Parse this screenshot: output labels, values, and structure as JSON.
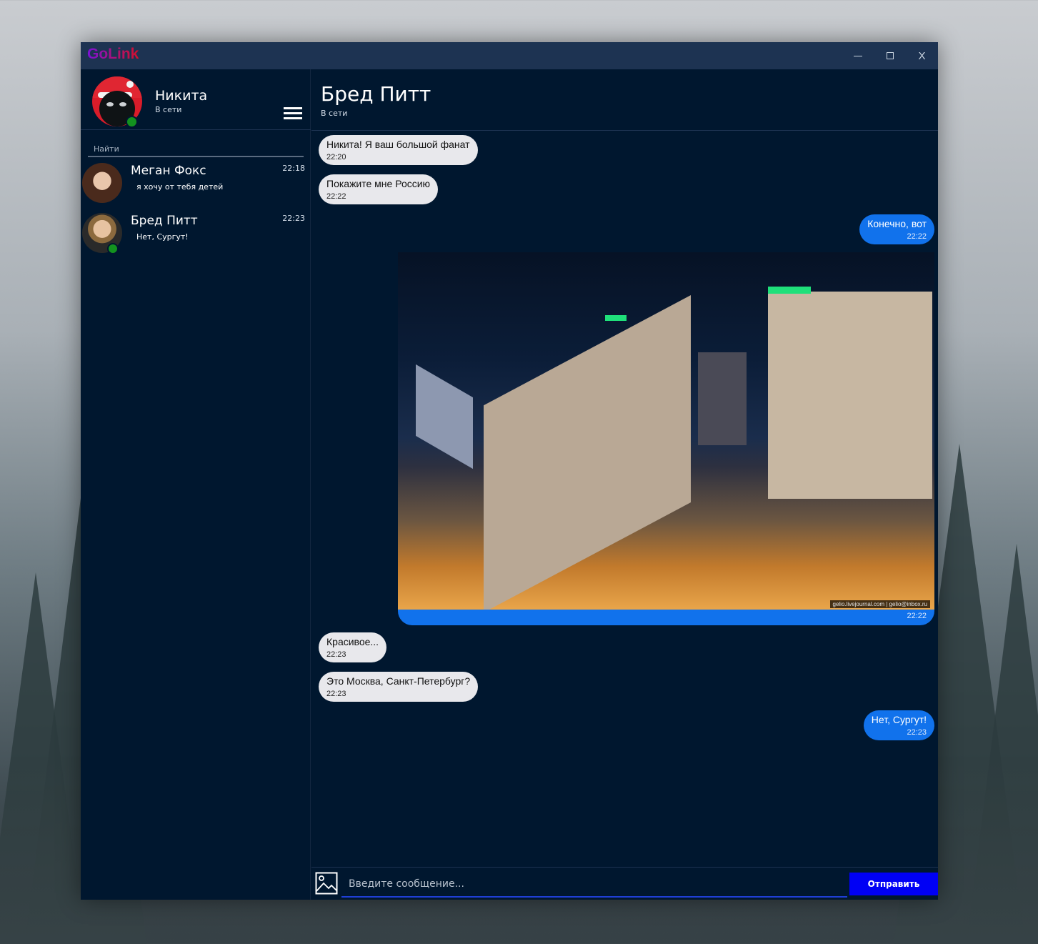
{
  "app": {
    "title": "GoLink"
  },
  "window_controls": {
    "minimize": "—",
    "maximize": "☐",
    "close": "X"
  },
  "profile": {
    "name": "Никита",
    "status": "В сети"
  },
  "search": {
    "placeholder": "Найти"
  },
  "contacts": [
    {
      "name": "Меган Фокс",
      "last_message": "я хочу от тебя детей",
      "time": "22:18",
      "online": false
    },
    {
      "name": "Бред Питт",
      "last_message": "Нет, Сургут!",
      "time": "22:23",
      "online": true
    }
  ],
  "chat": {
    "title": "Бред Питт",
    "status": "В сети",
    "messages": [
      {
        "dir": "in",
        "text": "Никита! Я ваш большой фанат",
        "time": "22:20"
      },
      {
        "dir": "in",
        "text": "Покажите мне Россию",
        "time": "22:22"
      },
      {
        "dir": "out",
        "text": "Конечно, вот",
        "time": "22:22"
      },
      {
        "dir": "out",
        "type": "image",
        "caption": "gelio.livejournal.com | gelio@inbox.ru",
        "time": "22:22"
      },
      {
        "dir": "in",
        "text": "Красивое...",
        "time": "22:23"
      },
      {
        "dir": "in",
        "text": "Это Москва, Санкт-Петербург?",
        "time": "22:23"
      },
      {
        "dir": "out",
        "text": "Нет, Сургут!",
        "time": "22:23"
      }
    ]
  },
  "composer": {
    "placeholder": "Введите сообщение...",
    "send_label": "Отправить"
  },
  "colors": {
    "window_bg": "#00172f",
    "titlebar": "#1d3352",
    "out_bubble": "#1172ec",
    "in_bubble": "#e8e8ec",
    "online": "#13921f",
    "send_button": "#0000f5"
  }
}
